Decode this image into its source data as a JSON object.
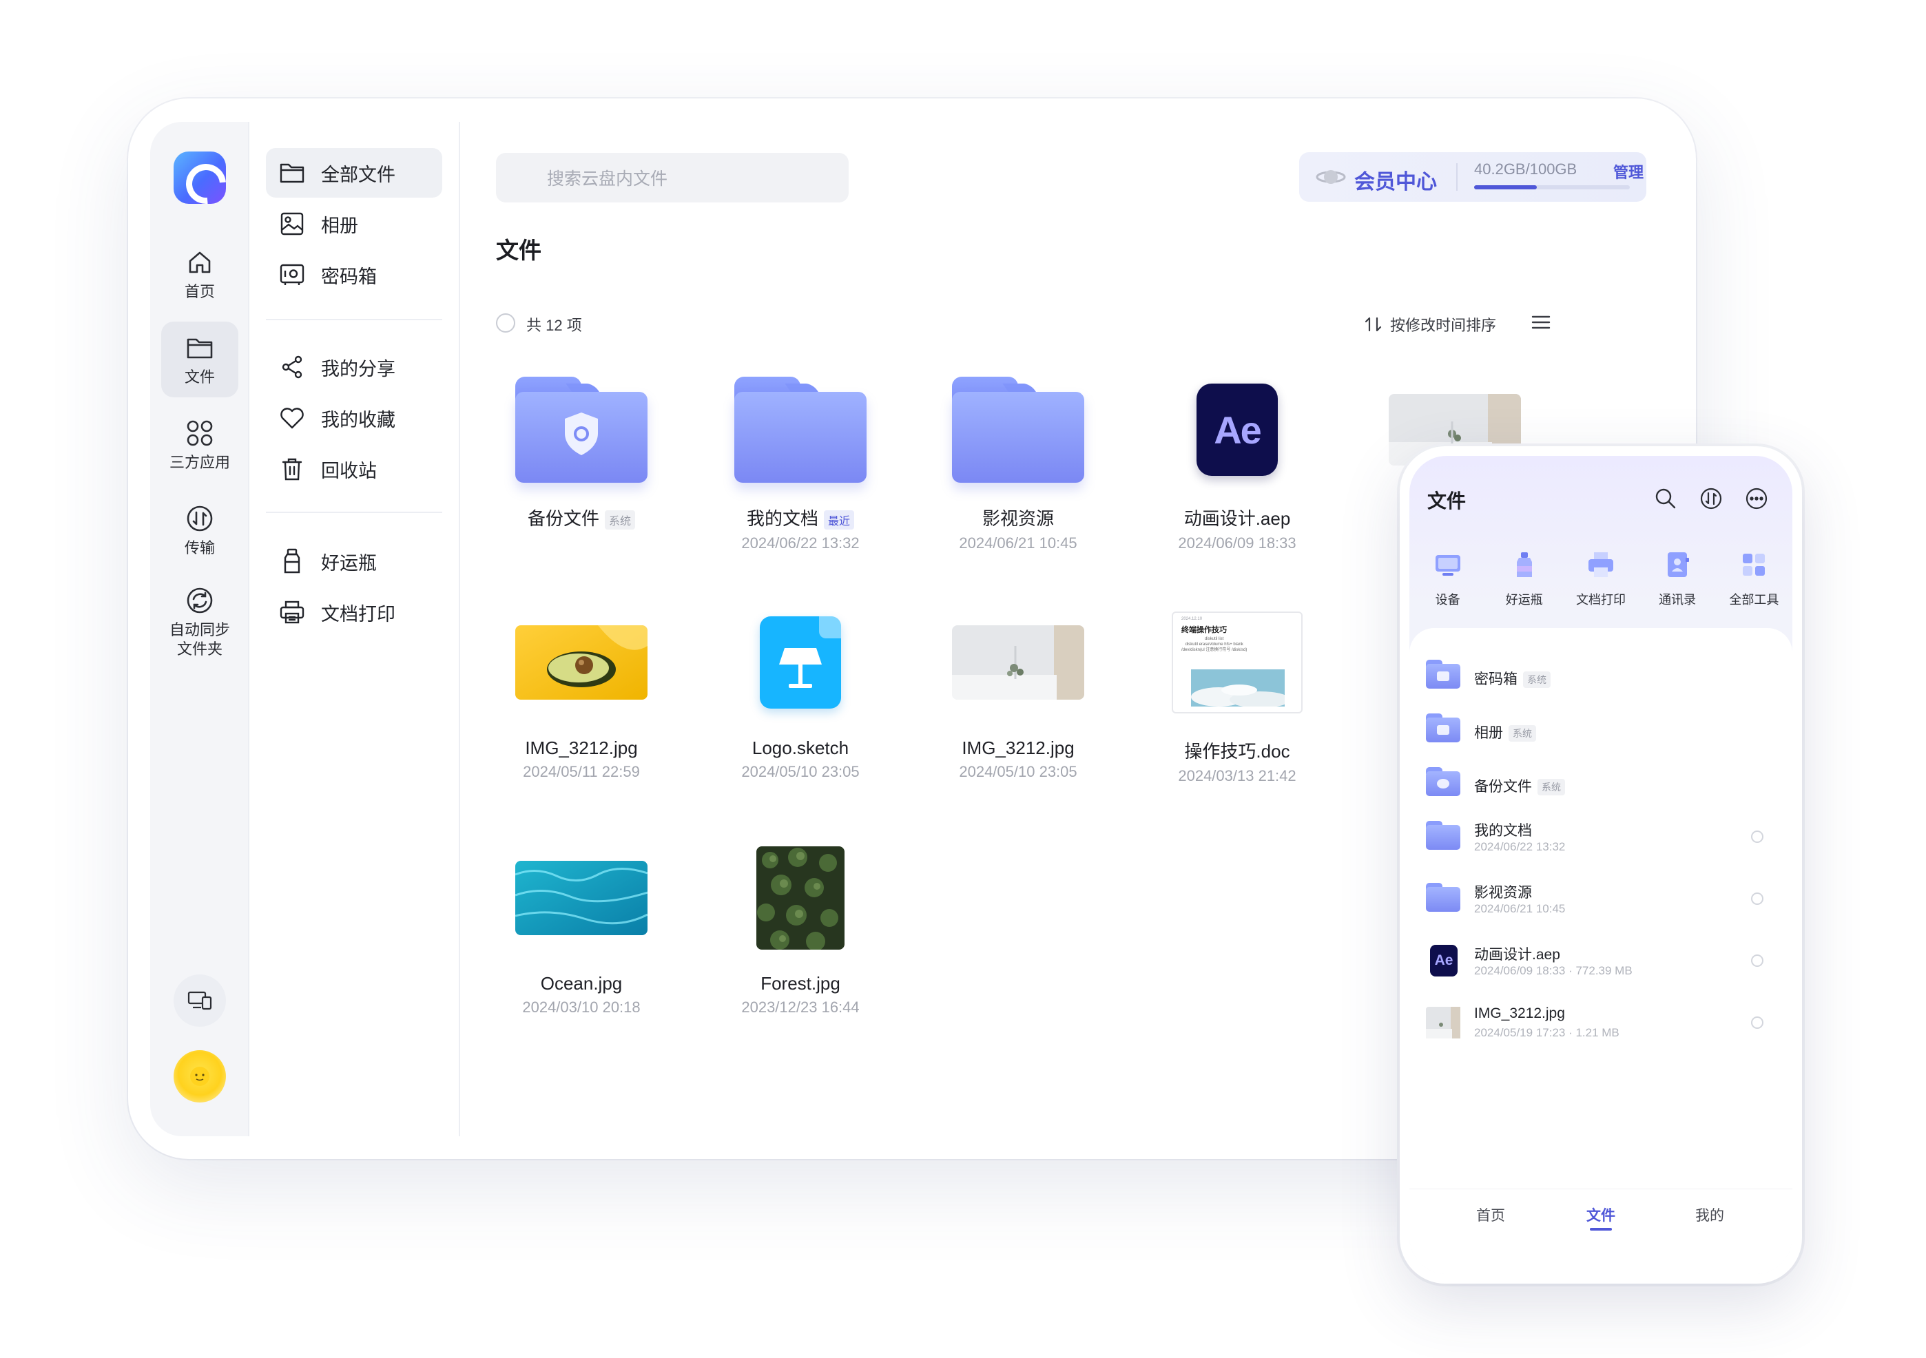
{
  "rail": {
    "items": [
      {
        "label": "首页",
        "icon": "home-icon"
      },
      {
        "label": "文件",
        "icon": "folder-icon",
        "active": true
      },
      {
        "label": "三方应用",
        "icon": "apps-icon"
      },
      {
        "label": "传输",
        "icon": "transfer-icon"
      },
      {
        "label": "自动同步\n文件夹",
        "icon": "sync-icon"
      }
    ]
  },
  "nav": {
    "items": [
      {
        "label": "全部文件",
        "icon": "folder-icon",
        "active": true
      },
      {
        "label": "相册",
        "icon": "album-icon"
      },
      {
        "label": "密码箱",
        "icon": "safe-icon"
      },
      {
        "label": "我的分享",
        "icon": "share-icon"
      },
      {
        "label": "我的收藏",
        "icon": "heart-icon"
      },
      {
        "label": "回收站",
        "icon": "trash-icon"
      },
      {
        "label": "好运瓶",
        "icon": "bottle-icon"
      },
      {
        "label": "文档打印",
        "icon": "printer-icon"
      }
    ]
  },
  "search": {
    "placeholder": "搜索云盘内文件"
  },
  "vip": {
    "title": "会员中心",
    "storage": "40.2GB/100GB",
    "manage": "管理",
    "used_fraction": 0.402
  },
  "main": {
    "title": "文件",
    "count": "共 12 项",
    "sort": "按修改时间排序"
  },
  "files": [
    {
      "name": "备份文件",
      "tag": "系统",
      "date": "",
      "kind": "folder-shield"
    },
    {
      "name": "我的文档",
      "tag": "最近",
      "date": "2024/06/22 13:32",
      "kind": "folder"
    },
    {
      "name": "影视资源",
      "tag": "",
      "date": "2024/06/21 10:45",
      "kind": "folder"
    },
    {
      "name": "动画设计.aep",
      "tag": "",
      "date": "2024/06/09 18:33",
      "kind": "ae"
    },
    {
      "name": "IMG_3212.jpg",
      "tag": "",
      "date": "2024/05/11 22:59",
      "kind": "photo-avocado"
    },
    {
      "name": "Logo.sketch",
      "tag": "",
      "date": "2024/05/10 23:05",
      "kind": "sketch"
    },
    {
      "name": "IMG_3212.jpg",
      "tag": "",
      "date": "2024/05/10 23:05",
      "kind": "photo-room"
    },
    {
      "name": "操作技巧.doc",
      "tag": "",
      "date": "2024/03/13 21:42",
      "kind": "doc"
    },
    {
      "name": "Ocean.jpg",
      "tag": "",
      "date": "2024/03/10 20:18",
      "kind": "photo-ocean"
    },
    {
      "name": "Forest.jpg",
      "tag": "",
      "date": "2023/12/23 16:44",
      "kind": "photo-forest"
    }
  ],
  "doc_preview": {
    "date": "2024.12.10",
    "heading": "终端操作技巧",
    "lines": [
      "diskutil list",
      "diskutil eraseVolume hfs+ blank",
      "/dev/diskn(ul 注意换行符号 /disk/sd)"
    ]
  },
  "phone": {
    "title": "文件",
    "tools": [
      {
        "label": "设备",
        "icon": "device-icon"
      },
      {
        "label": "好运瓶",
        "icon": "bottle-icon"
      },
      {
        "label": "文档打印",
        "icon": "printer-icon"
      },
      {
        "label": "通讯录",
        "icon": "contacts-icon"
      },
      {
        "label": "全部工具",
        "icon": "grid-icon"
      }
    ],
    "rows": [
      {
        "name": "密码箱",
        "tag": "系统",
        "meta": "",
        "kind": "safe"
      },
      {
        "name": "相册",
        "tag": "系统",
        "meta": "",
        "kind": "album"
      },
      {
        "name": "备份文件",
        "tag": "系统",
        "meta": "",
        "kind": "shield"
      },
      {
        "name": "我的文档",
        "tag": "",
        "meta": "2024/06/22 13:32",
        "kind": "folder"
      },
      {
        "name": "影视资源",
        "tag": "",
        "meta": "2024/06/21 10:45",
        "kind": "folder"
      },
      {
        "name": "动画设计.aep",
        "tag": "",
        "meta": "2024/06/09 18:33 · 772.39 MB",
        "kind": "ae"
      },
      {
        "name": "IMG_3212.jpg",
        "tag": "",
        "meta": "2024/05/19 17:23 · 1.21 MB",
        "kind": "photo"
      }
    ],
    "fab": "+",
    "tabs": [
      {
        "label": "首页"
      },
      {
        "label": "文件",
        "active": true
      },
      {
        "label": "我的"
      }
    ]
  },
  "colors": {
    "accent": "#4f57d8",
    "folder": "#8a9cfc",
    "rail_bg": "#f4f5f8"
  }
}
